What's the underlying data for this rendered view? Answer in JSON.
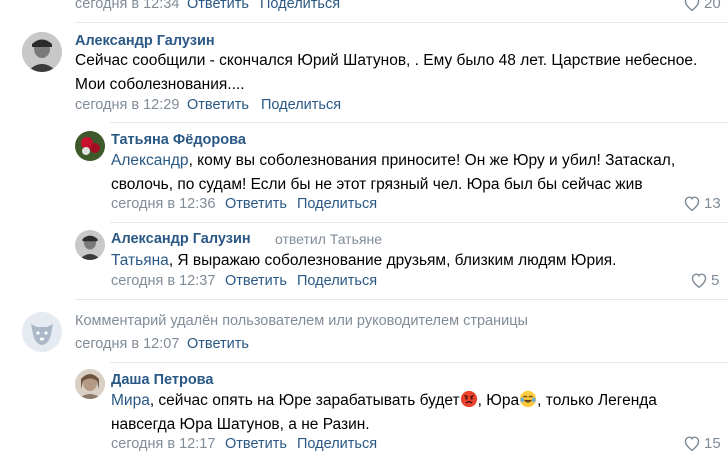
{
  "top": {
    "time": "сегодня в 12:34",
    "reply": "Ответить",
    "share": "Поделиться",
    "likes": "20"
  },
  "c1": {
    "author": "Александр Галузин",
    "text": "Сейчас сообщили - скончался Юрий Шатунов, . Ему было 48 лет. Царствие небесное. Мои соболезнования....",
    "time": "сегодня в 12:29",
    "reply": "Ответить",
    "share": "Поделиться"
  },
  "c2": {
    "author": "Татьяна Фёдорова",
    "mention": "Александр",
    "text": ", кому вы соболезнования приносите! Он же Юру и убил! Затаскал, сволочь, по судам! Если бы не этот грязный чел. Юра был бы сейчас жив",
    "time": "сегодня в 12:36",
    "reply": "Ответить",
    "share": "Поделиться",
    "likes": "13"
  },
  "c3": {
    "author": "Александр Галузин",
    "replied_to": "ответил Татьяне",
    "mention": "Татьяна",
    "text": ", Я выражаю соболезнование друзьям, близким людям Юрия.",
    "time": "сегодня в 12:37",
    "reply": "Ответить",
    "share": "Поделиться",
    "likes": "5"
  },
  "c4": {
    "deleted_text": "Комментарий удалён пользователем или руководителем страницы",
    "time": "сегодня в 12:07",
    "reply": "Ответить"
  },
  "c5": {
    "author": "Даша Петрова",
    "mention": "Мира",
    "text_a": ", сейчас опять на Юре зарабатывать будет",
    "text_b": ", Юра",
    "text_c": ", только Легенда навсегда Юра Шатунов, а не Разин.",
    "time": "сегодня в 12:17",
    "reply": "Ответить",
    "share": "Поделиться",
    "likes": "15"
  },
  "icons": {
    "like": "heart-icon",
    "angry_emoji": "angry-face-emoji",
    "laugh_emoji": "tears-of-joy-emoji",
    "deleted_avatar": "deleted-user-dog-icon"
  },
  "colors": {
    "link": "#2a5885",
    "meta": "#818c99",
    "divider": "#e7e8ec"
  }
}
